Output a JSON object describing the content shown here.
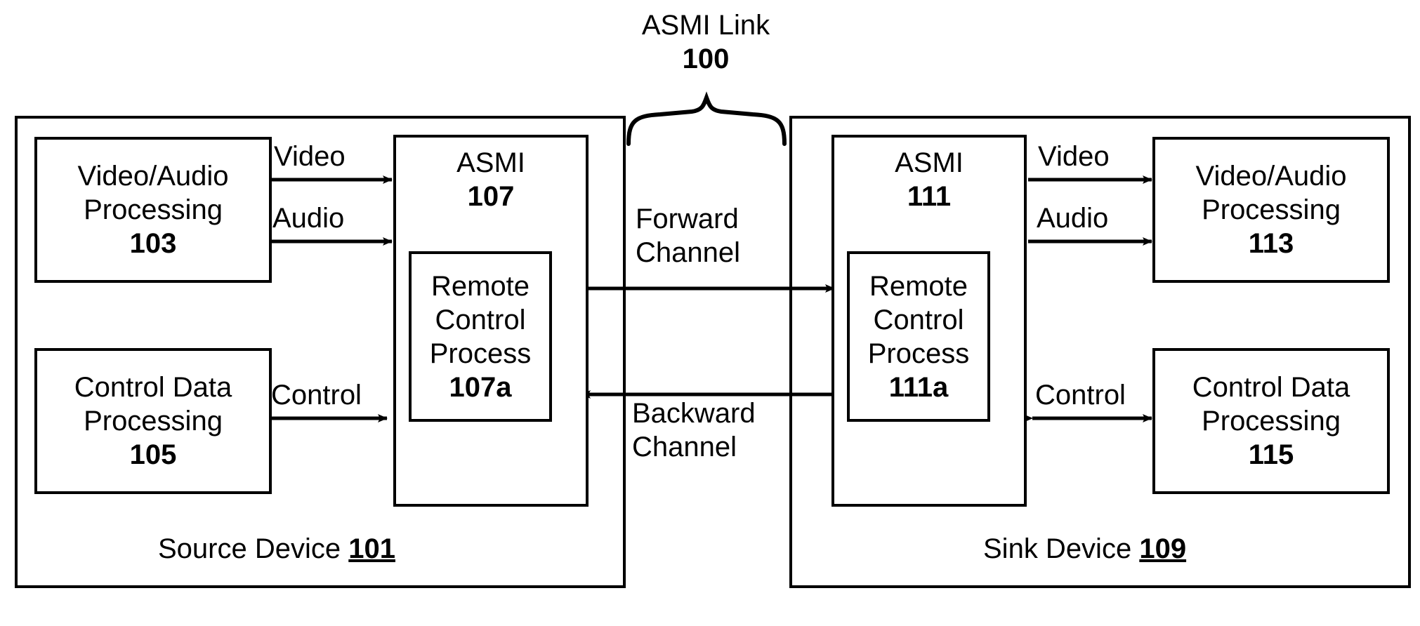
{
  "figure": {
    "link_title": "ASMI Link",
    "link_ref": "100",
    "brace_icon": "curly-brace-icon"
  },
  "source_device": {
    "label": "Source Device",
    "ref": "101",
    "blocks": [
      {
        "id": "va103",
        "title_line1": "Video/Audio",
        "title_line2": "Processing",
        "ref": "103"
      },
      {
        "id": "cd105",
        "title_line1": "Control Data",
        "title_line2": "Processing",
        "ref": "105"
      },
      {
        "id": "asmi107",
        "title_line1": "ASMI",
        "ref": "107"
      }
    ],
    "nested": {
      "id": "rcp107a",
      "line1": "Remote",
      "line2": "Control",
      "line3": "Process",
      "ref": "107a"
    },
    "arrows": [
      {
        "id": "video-arrow-src",
        "label": "Video",
        "direction": "right"
      },
      {
        "id": "audio-arrow-src",
        "label": "Audio",
        "direction": "right"
      },
      {
        "id": "control-arrow-src",
        "label": "Control",
        "direction": "both"
      }
    ]
  },
  "sink_device": {
    "label": "Sink Device",
    "ref": "109",
    "blocks": [
      {
        "id": "va113",
        "title_line1": "Video/Audio",
        "title_line2": "Processing",
        "ref": "113"
      },
      {
        "id": "cd115",
        "title_line1": "Control Data",
        "title_line2": "Processing",
        "ref": "115"
      },
      {
        "id": "asmi111",
        "title_line1": "ASMI",
        "ref": "111"
      }
    ],
    "nested": {
      "id": "rcp111a",
      "line1": "Remote",
      "line2": "Control",
      "line3": "Process",
      "ref": "111a"
    },
    "arrows": [
      {
        "id": "video-arrow-sink",
        "label": "Video",
        "direction": "right"
      },
      {
        "id": "audio-arrow-sink",
        "label": "Audio",
        "direction": "right"
      },
      {
        "id": "control-arrow-sink",
        "label": "Control",
        "direction": "both"
      }
    ]
  },
  "channels": {
    "forward": {
      "line1": "Forward",
      "line2": "Channel",
      "direction": "right"
    },
    "backward": {
      "line1": "Backward",
      "line2": "Channel",
      "direction": "left"
    }
  },
  "colors": {
    "stroke": "#000000",
    "background": "#ffffff"
  }
}
